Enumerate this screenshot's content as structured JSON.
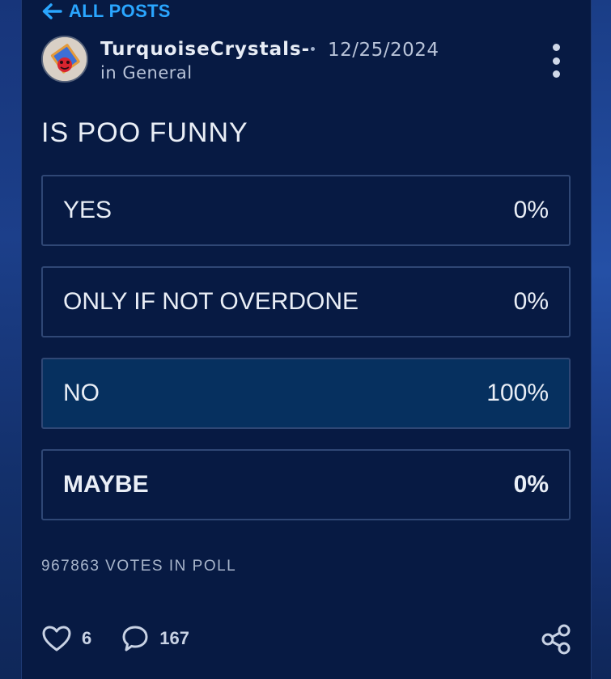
{
  "nav": {
    "back_label": "ALL POSTS"
  },
  "post": {
    "author": "TurquoiseCrystals-",
    "date": "12/25/2024",
    "category": "in General",
    "question": "IS POO FUNNY"
  },
  "poll": {
    "options": [
      {
        "label": "YES",
        "percent": "0%"
      },
      {
        "label": "ONLY IF NOT OVERDONE",
        "percent": "0%"
      },
      {
        "label": "NO",
        "percent": "100%"
      },
      {
        "label": "MAYBE",
        "percent": "0%"
      }
    ],
    "votes_text": "967863 VOTES IN POLL"
  },
  "actions": {
    "likes": "6",
    "comments": "167"
  },
  "icons": {
    "back": "arrow-left-icon",
    "more": "more-vertical-icon",
    "like": "heart-icon",
    "comment": "comment-icon",
    "share": "share-icon"
  },
  "colors": {
    "accent": "#2aa6ff",
    "panel_bg": "#071a43",
    "selected_option_bg": "#06305f",
    "border": "#2f4775"
  }
}
